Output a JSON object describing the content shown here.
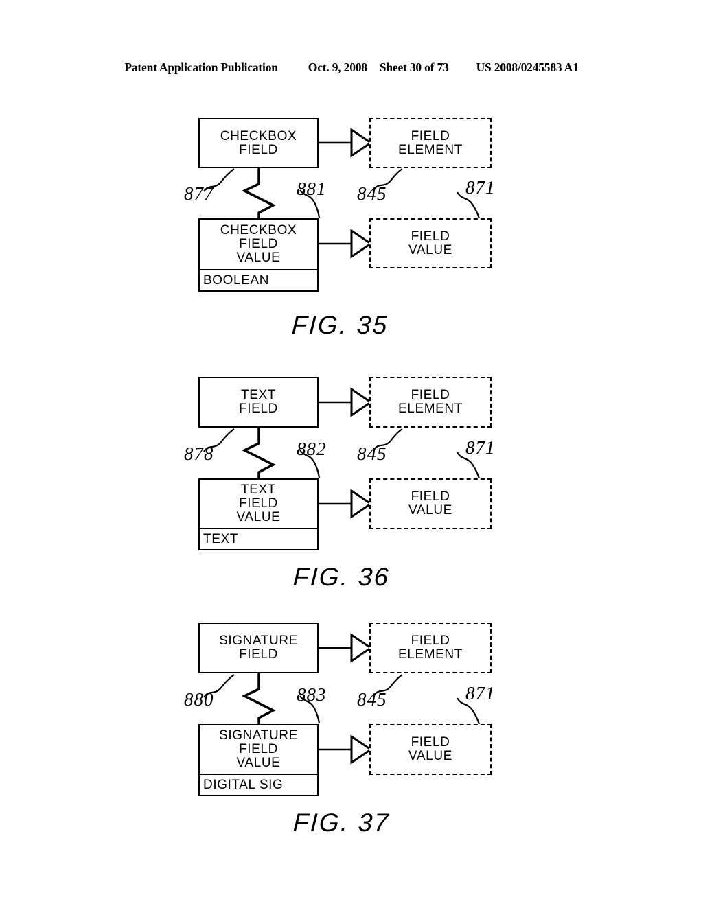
{
  "header": {
    "publication": "Patent Application Publication",
    "date": "Oct. 9, 2008",
    "sheet": "Sheet 30 of 73",
    "number": "US 2008/0245583 A1"
  },
  "figures": [
    {
      "caption": "FIG. 35",
      "field_node": {
        "title_line1": "CHECKBOX",
        "title_line2": "FIELD",
        "ref": "877"
      },
      "value_node": {
        "title_line1": "CHECKBOX",
        "title_line2": "FIELD",
        "title_line3": "VALUE",
        "type": "BOOLEAN",
        "ref": "881"
      },
      "element_node": {
        "title_line1": "FIELD",
        "title_line2": "ELEMENT",
        "ref": "845"
      },
      "element_value_node": {
        "title_line1": "FIELD",
        "title_line2": "VALUE",
        "ref": "871"
      }
    },
    {
      "caption": "FIG. 36",
      "field_node": {
        "title_line1": "TEXT",
        "title_line2": "FIELD",
        "ref": "878"
      },
      "value_node": {
        "title_line1": "TEXT",
        "title_line2": "FIELD",
        "title_line3": "VALUE",
        "type": "TEXT",
        "ref": "882"
      },
      "element_node": {
        "title_line1": "FIELD",
        "title_line2": "ELEMENT",
        "ref": "845"
      },
      "element_value_node": {
        "title_line1": "FIELD",
        "title_line2": "VALUE",
        "ref": "871"
      }
    },
    {
      "caption": "FIG. 37",
      "field_node": {
        "title_line1": "SIGNATURE",
        "title_line2": "FIELD",
        "ref": "880"
      },
      "value_node": {
        "title_line1": "SIGNATURE",
        "title_line2": "FIELD",
        "title_line3": "VALUE",
        "type": "DIGITAL SIG",
        "ref": "883"
      },
      "element_node": {
        "title_line1": "FIELD",
        "title_line2": "ELEMENT",
        "ref": "845"
      },
      "element_value_node": {
        "title_line1": "FIELD",
        "title_line2": "VALUE",
        "ref": "871"
      }
    }
  ]
}
